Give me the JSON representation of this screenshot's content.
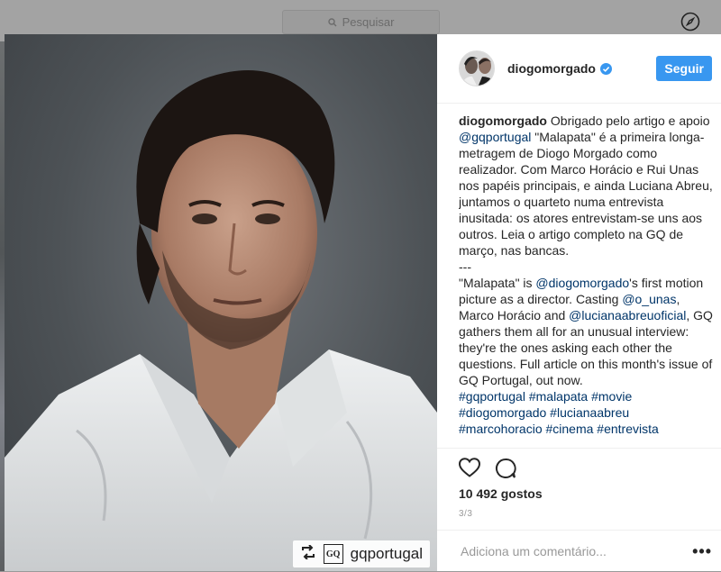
{
  "topbar": {
    "search_placeholder": "Pesquisar",
    "icons": [
      "search-icon",
      "compass-icon"
    ]
  },
  "post": {
    "username": "diogomorgado",
    "verified": true,
    "follow_label": "Seguir",
    "image_watermark_handle": "gqportugal",
    "caption": {
      "author": "diogomorgado",
      "p1_before": " Obrigado pelo artigo e apoio ",
      "p1_mention": "@gqportugal",
      "p1_after": " \"Malapata\" é a primeira longa-metragem de Diogo Morgado como realizador. Com Marco Horácio e Rui Unas nos papéis principais, e ainda Luciana Abreu, juntamos o quarteto numa entrevista inusitada: os atores entrevistam-se uns aos outros. Leia o artigo completo na GQ de março, nas bancas.",
      "separator": "---",
      "p2_a": "\"Malapata\" is ",
      "p2_mention1": "@diogomorgado",
      "p2_b": "'s first motion picture as a director. Casting ",
      "p2_mention2": "@o_unas",
      "p2_c": ", Marco Horácio and ",
      "p2_mention3": "@lucianaabreuoficial",
      "p2_d": ", GQ gathers them all for an unusual interview: they're the ones asking each other the questions. Full article on this month's issue of GQ Portugal, out now.",
      "hashtags_line1": "#gqportugal #malapata #movie",
      "hashtags_line2": "#diogomorgado #lucianaabreu",
      "hashtags_line3": "#marcohoracio #cinema #entrevista"
    },
    "likes_text": "10 492 gostos",
    "pager_text": "3/3",
    "comment_placeholder": "Adiciona um comentário...",
    "more_label": "•••",
    "colors": {
      "follow_button": "#3897f0",
      "link": "#003569",
      "verified_badge": "#3897f0"
    }
  }
}
